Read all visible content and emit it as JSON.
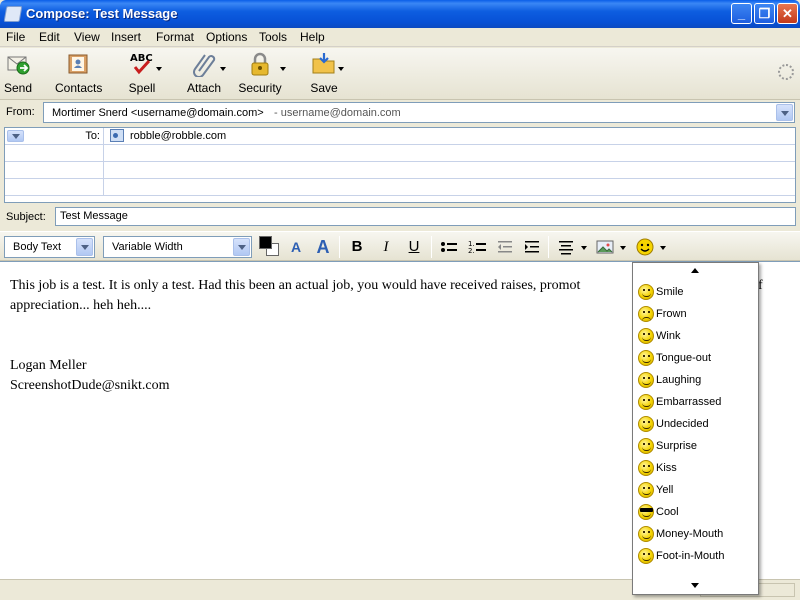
{
  "window": {
    "title": "Compose: Test Message"
  },
  "menu": [
    "File",
    "Edit",
    "View",
    "Insert",
    "Format",
    "Options",
    "Tools",
    "Help"
  ],
  "toolbar": {
    "send": "Send",
    "contacts": "Contacts",
    "spell": "Spell",
    "attach": "Attach",
    "security": "Security",
    "save": "Save"
  },
  "headers": {
    "from_label": "From:",
    "from_identity": "Mortimer Snerd <username@domain.com>",
    "from_account": "- username@domain.com",
    "recipient_type": "To:",
    "recipient": "robble@robble.com",
    "subject_label": "Subject:",
    "subject_value": "Test Message"
  },
  "format": {
    "paragraph_style": "Body Text",
    "font": "Variable Width",
    "bold": "B",
    "italic": "I",
    "underline": "U"
  },
  "body": {
    "line1": "This job is a test.  It is only a test.  Had this been an actual job, you would have received raises, promot",
    "line1_tail": "f",
    "line2": "appreciation... heh heh....",
    "signature_name": "Logan Meller",
    "signature_email": "ScreenshotDude@snikt.com"
  },
  "smileys": [
    {
      "label": "Smile",
      "icon": "smile-icon"
    },
    {
      "label": "Frown",
      "icon": "frown-icon"
    },
    {
      "label": "Wink",
      "icon": "wink-icon"
    },
    {
      "label": "Tongue-out",
      "icon": "tongue-out-icon"
    },
    {
      "label": "Laughing",
      "icon": "laughing-icon"
    },
    {
      "label": "Embarrassed",
      "icon": "embarrassed-icon"
    },
    {
      "label": "Undecided",
      "icon": "undecided-icon"
    },
    {
      "label": "Surprise",
      "icon": "surprise-icon"
    },
    {
      "label": "Kiss",
      "icon": "kiss-icon"
    },
    {
      "label": "Yell",
      "icon": "yell-icon"
    },
    {
      "label": "Cool",
      "icon": "cool-icon"
    },
    {
      "label": "Money-Mouth",
      "icon": "money-mouth-icon"
    },
    {
      "label": "Foot-in-Mouth",
      "icon": "foot-in-mouth-icon"
    }
  ]
}
